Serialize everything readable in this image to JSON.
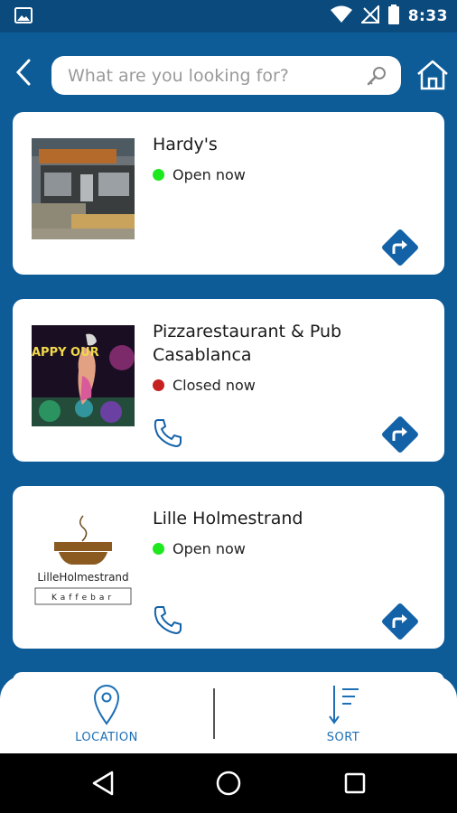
{
  "status_bar": {
    "time": "8:33"
  },
  "search": {
    "placeholder": "What are you looking for?"
  },
  "listings": [
    {
      "name": "Hardy's",
      "status": "Open now",
      "status_color": "#1ee81e",
      "has_phone": false
    },
    {
      "name": "Pizzarestaurant & Pub Casablanca",
      "status": "Closed now",
      "status_color": "#c62020",
      "has_phone": true
    },
    {
      "name": "Lille Holmestrand",
      "status": "Open now",
      "status_color": "#1ee81e",
      "has_phone": true
    }
  ],
  "thumbnails": {
    "happy_hour_text": "APPY OUR",
    "logo_text": "LilleHolmestrand",
    "logo_subtext": "Kaffebar"
  },
  "bottom_bar": {
    "location_label": "LOCATION",
    "sort_label": "SORT"
  },
  "colors": {
    "brand_blue": "#0d5c98",
    "accent_blue": "#1c6fb5",
    "button_blue": "#1362a8"
  }
}
